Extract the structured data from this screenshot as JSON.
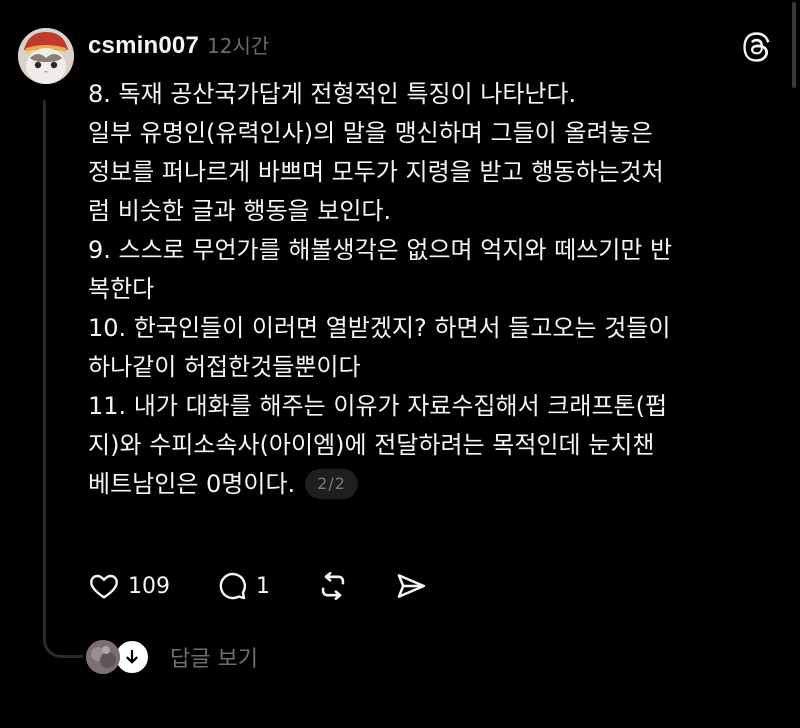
{
  "post": {
    "username": "csmin007",
    "timestamp": "12시간",
    "lines": [
      "8. 독재 공산국가답게 전형적인 특징이 나타난다.",
      "일부 유명인(유력인사)의 말을 맹신하며 그들이 올려놓은",
      "정보를 퍼나르게 바쁘며 모두가 지령을 받고 행동하는것처",
      "럼 비슷한 글과 행동을 보인다.",
      "9. 스스로 무언가를 해볼생각은 없으며 억지와 떼쓰기만 반",
      "복한다",
      "10. 한국인들이 이러면 열받겠지? 하면서 들고오는 것들이",
      "하나같이 허접한것들뿐이다",
      "11. 내가 대화를 해주는 이유가 자료수집해서 크래프톤(펍",
      "지)와 수피소속사(아이엠)에 전달하려는 목적인데 눈치챈",
      "베트남인은 0명이다."
    ],
    "page_indicator": "2/2"
  },
  "actions": {
    "like_count": "109",
    "reply_count": "1"
  },
  "replies": {
    "view_label": "답글 보기"
  },
  "icons": {
    "brand": "threads-logo-icon",
    "like": "heart-icon",
    "reply": "comment-icon",
    "repost": "repost-icon",
    "share": "send-icon",
    "expand": "arrow-down-icon"
  },
  "colors": {
    "background": "#000000",
    "text": "#f3f5f7",
    "muted": "#6b6b6b",
    "thread_line": "#2a2a2a"
  }
}
